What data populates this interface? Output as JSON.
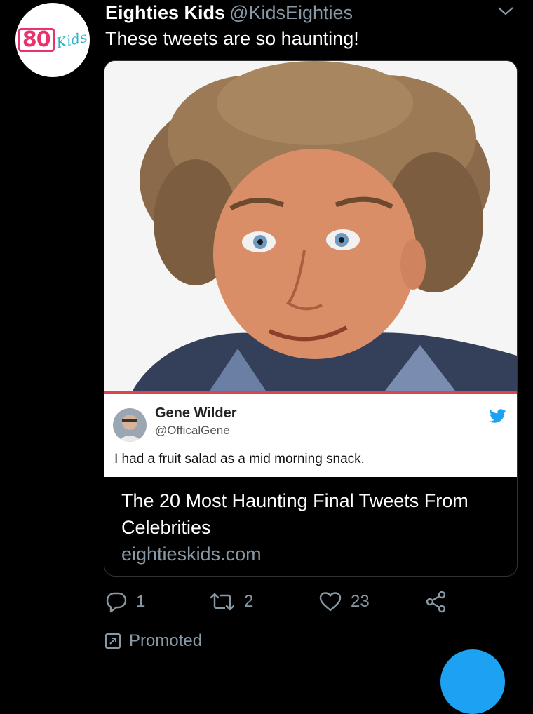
{
  "tweet": {
    "author_name": "Eighties Kids",
    "author_handle": "@KidsEighties",
    "avatar_logo_number": "80",
    "avatar_logo_word": "Kids",
    "text": "These tweets are so haunting!",
    "accent_color": "#1da1f2"
  },
  "card": {
    "title": "The 20 Most Haunting Final Tweets From Celebrities",
    "domain": "eightieskids.com",
    "embedded_tweet": {
      "name": "Gene Wilder",
      "handle": "@OfficalGene",
      "text": "I had a fruit salad as a mid morning snack.",
      "accent_bar_color": "#d8454d"
    }
  },
  "actions": {
    "reply_count": "1",
    "retweet_count": "2",
    "like_count": "23",
    "icons": [
      "reply-icon",
      "retweet-icon",
      "like-icon",
      "share-icon"
    ]
  },
  "promoted_label": "Promoted"
}
